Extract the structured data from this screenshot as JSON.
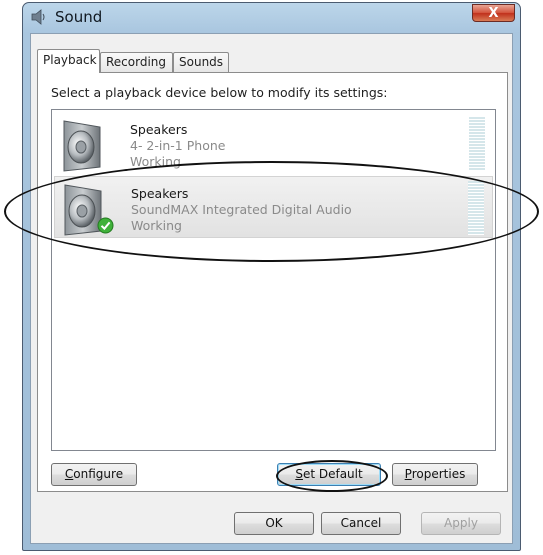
{
  "window": {
    "title": "Sound",
    "close_symbol": "X",
    "icons": {
      "app": "speaker-icon",
      "close": "close-icon"
    }
  },
  "tabs": [
    {
      "label": "Playback",
      "active": true
    },
    {
      "label": "Recording",
      "active": false
    },
    {
      "label": "Sounds",
      "active": false
    }
  ],
  "playback": {
    "instruction": "Select a playback device below to modify its settings:",
    "devices": [
      {
        "name": "Speakers",
        "description": "4- 2-in-1 Phone",
        "status": "Working",
        "is_default": false,
        "selected": false,
        "icon": "speaker-icon"
      },
      {
        "name": "Speakers",
        "description": "SoundMAX Integrated Digital Audio",
        "status": "Working",
        "is_default": true,
        "selected": true,
        "icon": "speaker-icon",
        "badge_icon": "default-checkmark-icon"
      }
    ]
  },
  "panel_buttons": {
    "configure": {
      "label": "Configure",
      "accesskey": "C",
      "rest": "onfigure"
    },
    "set_default": {
      "label": "Set Default",
      "accesskey": "S",
      "rest": "et Default"
    },
    "properties": {
      "label": "Properties",
      "accesskey": "P",
      "rest": "roperties"
    }
  },
  "dialog_buttons": {
    "ok": {
      "label": "OK"
    },
    "cancel": {
      "label": "Cancel"
    },
    "apply": {
      "label": "Apply",
      "enabled": false
    }
  },
  "colors": {
    "frame": "#a9c6df",
    "close_button": "#c0301c",
    "selection": "#e2e2e2",
    "default_check": "#3fb13a"
  }
}
